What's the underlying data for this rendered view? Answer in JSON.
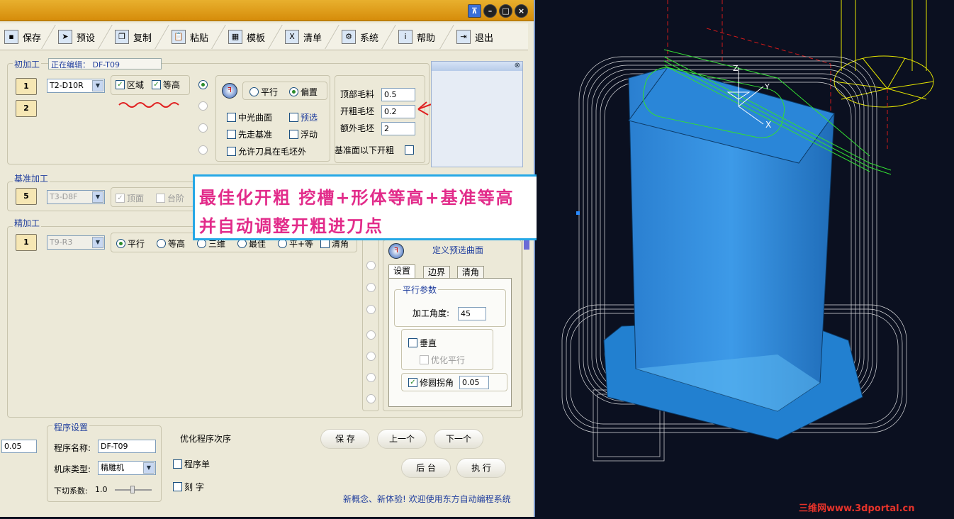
{
  "toolbar": {
    "items": [
      {
        "label": "保存",
        "icon": "save-icon"
      },
      {
        "label": "预设",
        "icon": "cursor-icon"
      },
      {
        "label": "复制",
        "icon": "copy-icon"
      },
      {
        "label": "粘贴",
        "icon": "paste-icon"
      },
      {
        "label": "模板",
        "icon": "template-icon"
      },
      {
        "label": "清单",
        "icon": "excel-icon"
      },
      {
        "label": "系统",
        "icon": "gear-icon"
      },
      {
        "label": "帮助",
        "icon": "info-icon"
      },
      {
        "label": "退出",
        "icon": "exit-icon"
      }
    ]
  },
  "rough": {
    "group_label": "初加工",
    "editing_label": "正在编辑：",
    "editing_name": "DF-T09",
    "btn1": "1",
    "btn2": "2",
    "tool": "T2-D10R",
    "region": "区域",
    "contour": "等高",
    "parallel": "平行",
    "offset": "偏置",
    "mid_surface": "中光曲面",
    "preselect": "预选",
    "first_base": "先走基准",
    "float": "浮动",
    "allow_outside": "允许刀具在毛坯外",
    "top_stock_label": "顶部毛料",
    "top_stock": "0.5",
    "rough_stock_label": "开粗毛坯",
    "rough_stock": "0.2",
    "extra_stock_label": "额外毛坯",
    "extra_stock": "2",
    "below_base": "基准面以下开粗"
  },
  "base": {
    "group_label": "基准加工",
    "btn": "5",
    "tool": "T3-D8F",
    "top": "顶面",
    "step": "台阶"
  },
  "finish": {
    "group_label": "精加工",
    "btn": "1",
    "tool": "T9-R3",
    "parallel": "平行",
    "contour": "等高",
    "three_d": "三维",
    "best": "最佳",
    "plus_equal": "平+等",
    "clear": "清角",
    "define_surface": "定义预选曲面",
    "tabs": [
      "设置",
      "边界",
      "清角"
    ],
    "params_label": "平行参数",
    "angle_label": "加工角度:",
    "angle": "45",
    "vertical": "垂直",
    "opt_parallel": "优化平行",
    "round_corner": "修圆拐角",
    "round_value": "0.05"
  },
  "program": {
    "left_value": "0.05",
    "group_label": "程序设置",
    "name_label": "程序名称:",
    "name": "DF-T09",
    "machine_label": "机床类型:",
    "machine": "精雕机",
    "cut_label": "下切系数:",
    "cut_value": "1.0",
    "optimize": "优化程序次序",
    "program_sheet": "程序单",
    "engrave": "刻 字",
    "save": "保 存",
    "prev": "上一个",
    "next": "下一个",
    "backend": "后 台",
    "execute": "执 行",
    "welcome": "新概念、新体验! 欢迎使用东方自动编程系统"
  },
  "overlay": {
    "line1": "最佳化开粗 挖槽+形体等高+基准等高",
    "line2": "并自动调整开粗进刀点"
  },
  "viewport": {
    "axis_x": "X",
    "axis_y": "Y",
    "axis_z": "Z",
    "watermark": "三维网www.3dportal.cn"
  },
  "colors": {
    "accent": "#213f9e",
    "title": "#d9990f",
    "overlay_text": "#e22b8a",
    "overlay_border": "#26a8e6",
    "model_blue": "#2c8fe0"
  }
}
